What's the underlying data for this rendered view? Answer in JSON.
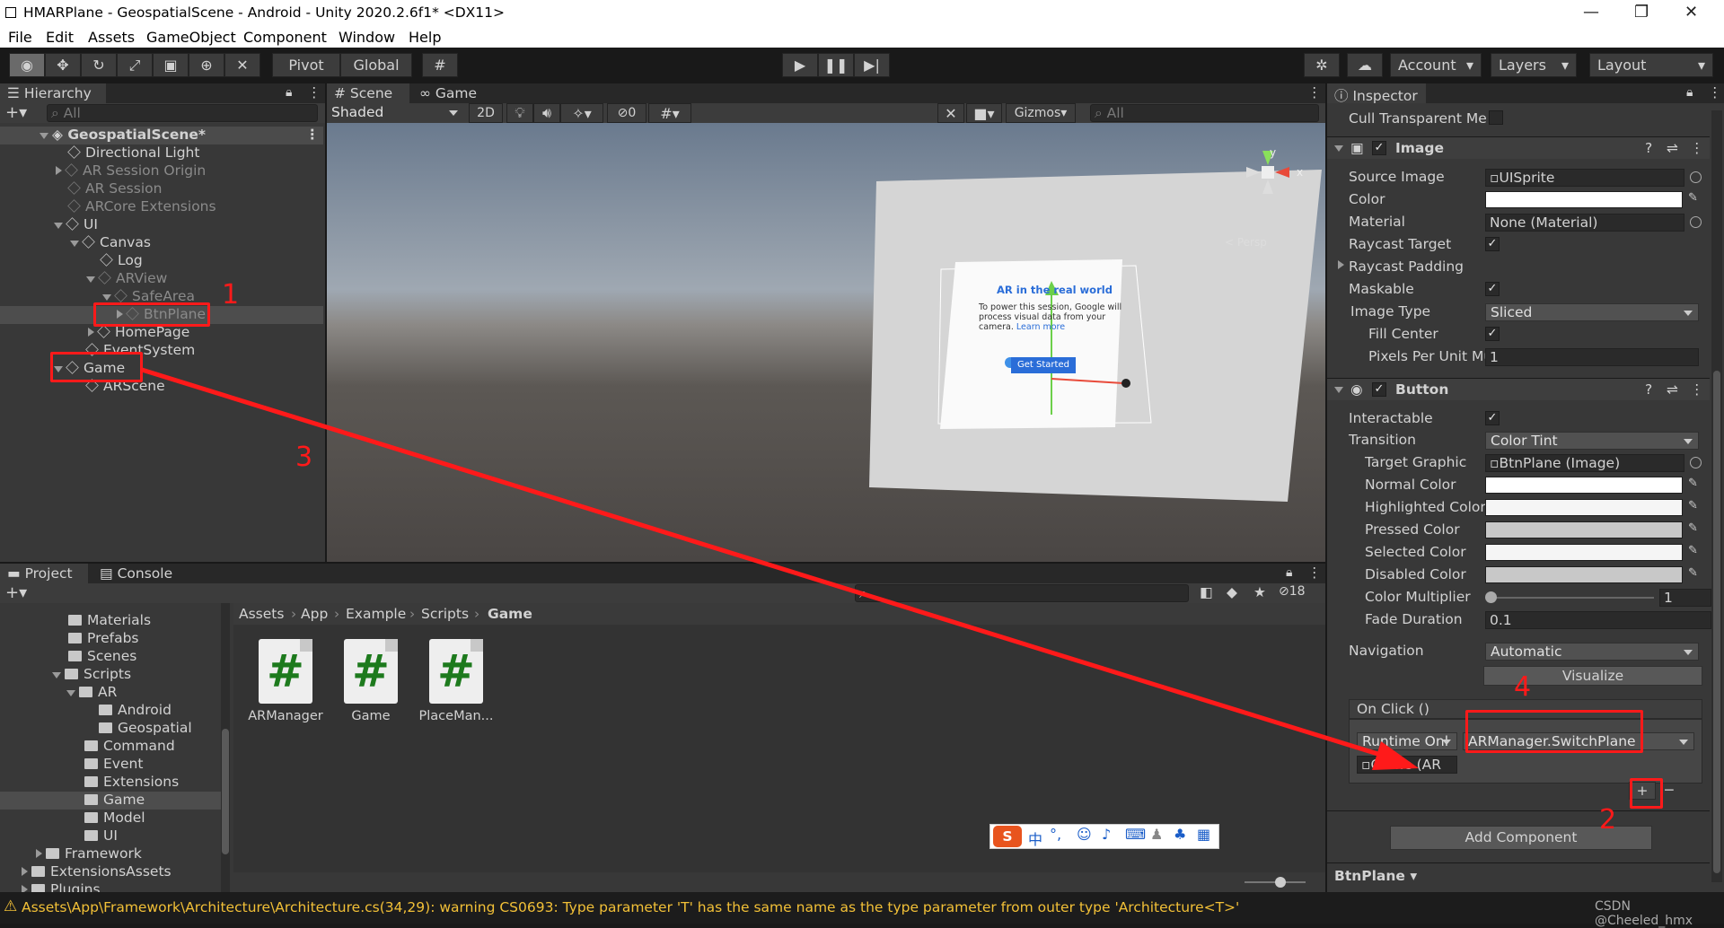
{
  "window": {
    "title": "HMARPlane - GeospatialScene - Android - Unity 2020.2.6f1* <DX11>"
  },
  "menu": [
    "File",
    "Edit",
    "Assets",
    "GameObject",
    "Component",
    "Window",
    "Help"
  ],
  "toolbar": {
    "pivot": "Pivot",
    "global": "Global",
    "account": "Account",
    "layers": "Layers",
    "layout": "Layout"
  },
  "hierarchy": {
    "tab": "Hierarchy",
    "search_placeholder": "All",
    "scene": "GeospatialScene*",
    "items": [
      "Directional Light",
      "AR Session Origin",
      "AR Session",
      "ARCore Extensions",
      "UI",
      "Canvas",
      "Log",
      "ARView",
      "SafeArea",
      "BtnPlane",
      "HomePage",
      "EventSystem",
      "Game",
      "ARScene"
    ]
  },
  "scene": {
    "tab_scene": "Scene",
    "tab_game": "Game",
    "shading": "Shaded",
    "mode_2d": "2D",
    "hidden_count": "0",
    "gizmos": "Gizmos",
    "search_placeholder": "All",
    "persp": "< Persp",
    "card": {
      "title": "AR in the real world",
      "body": "To power this session, Google will process visual data from your camera.",
      "learn": "Learn more",
      "button": "Get Started"
    }
  },
  "project": {
    "tab_project": "Project",
    "tab_console": "Console",
    "hidden_count": "18",
    "folders": [
      "Materials",
      "Prefabs",
      "Scenes",
      "Scripts",
      "AR",
      "Android",
      "Geospatial",
      "Command",
      "Event",
      "Extensions",
      "Game",
      "Model",
      "UI",
      "Framework",
      "ExtensionsAssets",
      "Plugins"
    ],
    "breadcrumb": [
      "Assets",
      "App",
      "Example",
      "Scripts",
      "Game"
    ],
    "files": [
      "ARManager",
      "Game",
      "PlaceMan..."
    ]
  },
  "ime": {
    "label": "中"
  },
  "inspector": {
    "tab": "Inspector",
    "cull": "Cull Transparent Me",
    "image": {
      "header": "Image",
      "source_label": "Source Image",
      "source": "UISprite",
      "color_label": "Color",
      "material_label": "Material",
      "material": "None (Material)",
      "raycast_label": "Raycast Target",
      "padding_label": "Raycast Padding",
      "maskable_label": "Maskable",
      "type_label": "Image Type",
      "type": "Sliced",
      "fill_label": "Fill Center",
      "ppu_label": "Pixels Per Unit Mu",
      "ppu": "1"
    },
    "button": {
      "header": "Button",
      "interactable_label": "Interactable",
      "transition_label": "Transition",
      "transition": "Color Tint",
      "target_label": "Target Graphic",
      "target": "BtnPlane (Image)",
      "normal_label": "Normal Color",
      "highlighted_label": "Highlighted Color",
      "pressed_label": "Pressed Color",
      "selected_label": "Selected Color",
      "disabled_label": "Disabled Color",
      "multiplier_label": "Color Multiplier",
      "multiplier": "1",
      "fade_label": "Fade Duration",
      "fade": "0.1",
      "nav_label": "Navigation",
      "nav": "Automatic",
      "visualize": "Visualize"
    },
    "onclick": {
      "header": "On Click ()",
      "runtime": "Runtime Onl",
      "function": "ARManager.SwitchPlane",
      "object": "Game (AR"
    },
    "add_component": "Add Component",
    "footer": "BtnPlane"
  },
  "annotations": [
    "1",
    "2",
    "3",
    "4"
  ],
  "status": {
    "warning": "Assets\\App\\Framework\\Architecture\\Architecture.cs(34,29): warning CS0693: Type parameter 'T' has the same name as the type parameter from outer type 'Architecture<T>'",
    "watermark": "CSDN @Cheeled_hmx"
  },
  "colors": {
    "accent_red": "#ff1a1a",
    "warning": "#f2c037",
    "panel": "#383838",
    "selection": "#4d4d4d"
  }
}
